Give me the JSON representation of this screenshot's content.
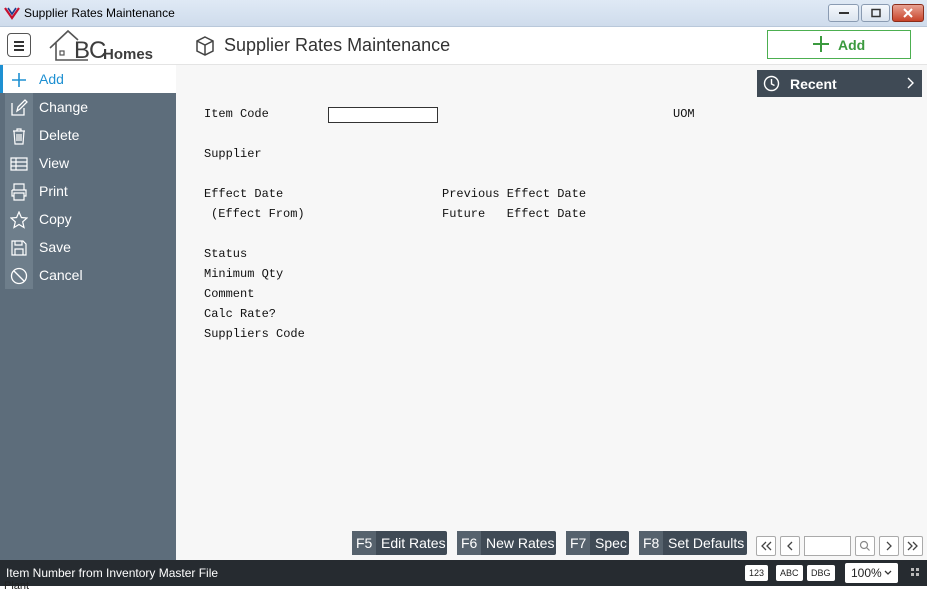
{
  "window": {
    "title": "Supplier Rates Maintenance"
  },
  "header": {
    "logo_bc": "BC",
    "logo_homes": "Homes",
    "page_title": "Supplier Rates Maintenance",
    "add_label": "Add"
  },
  "sidebar": {
    "items": [
      {
        "label": "Add",
        "icon": "plus-icon",
        "active": true
      },
      {
        "label": "Change",
        "icon": "edit-icon"
      },
      {
        "label": "Delete",
        "icon": "trash-icon"
      },
      {
        "label": "View",
        "icon": "table-icon"
      },
      {
        "label": "Print",
        "icon": "printer-icon"
      },
      {
        "label": "Copy",
        "icon": "star-icon"
      },
      {
        "label": "Save",
        "icon": "save-icon"
      },
      {
        "label": "Cancel",
        "icon": "cancel-icon"
      }
    ]
  },
  "recent": {
    "label": "Recent"
  },
  "form": {
    "item_code": "Item Code",
    "uom": "UOM",
    "supplier": "Supplier",
    "effect_date": "Effect Date",
    "effect_from": "(Effect From)",
    "previous_effect_date": "Previous Effect Date",
    "future_effect_date": "Future   Effect Date",
    "status": "Status",
    "minimum_qty": "Minimum Qty",
    "comment": "Comment",
    "calc_rate": "Calc Rate?",
    "suppliers_code": "Suppliers Code",
    "item_code_value": ""
  },
  "fkeys": [
    {
      "key": "F5",
      "label": "Edit Rates"
    },
    {
      "key": "F6",
      "label": "New Rates"
    },
    {
      "key": "F7",
      "label": "Spec"
    },
    {
      "key": "F8",
      "label": "Set Defaults"
    }
  ],
  "statusbar": {
    "message": "Item Number from Inventory Master File",
    "tag_123": "123",
    "tag_abc": "ABC",
    "tag_dbg": "DBG",
    "zoom": "100%"
  },
  "underlay": {
    "plant": "Plant"
  },
  "colors": {
    "sidebar": "#5d6d7b",
    "accent": "#1e90d2",
    "add_green": "#3b9a3e",
    "dark": "#3f4a55",
    "statusbar": "#262b30"
  }
}
